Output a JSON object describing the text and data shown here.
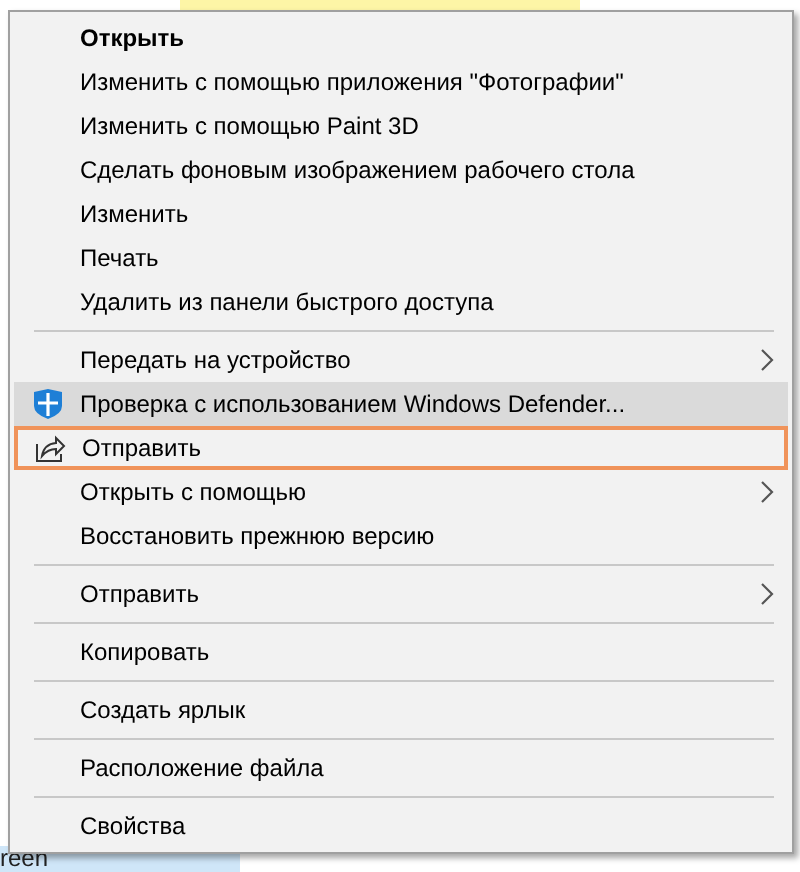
{
  "background": {
    "fragment_text": "reen"
  },
  "menu": {
    "items": [
      {
        "kind": "plain",
        "label": "Открыть",
        "default": true,
        "highlighted": false,
        "focused": false,
        "submenu": false
      },
      {
        "kind": "plain",
        "label": "Изменить с помощью приложения \"Фотографии\"",
        "default": false,
        "highlighted": false,
        "focused": false,
        "submenu": false
      },
      {
        "kind": "plain",
        "label": "Изменить с помощью Paint 3D",
        "default": false,
        "highlighted": false,
        "focused": false,
        "submenu": false
      },
      {
        "kind": "plain",
        "label": "Сделать фоновым изображением рабочего стола",
        "default": false,
        "highlighted": false,
        "focused": false,
        "submenu": false
      },
      {
        "kind": "plain",
        "label": "Изменить",
        "default": false,
        "highlighted": false,
        "focused": false,
        "submenu": false
      },
      {
        "kind": "plain",
        "label": "Печать",
        "default": false,
        "highlighted": false,
        "focused": false,
        "submenu": false
      },
      {
        "kind": "plain",
        "label": "Удалить из панели быстрого доступа",
        "default": false,
        "highlighted": false,
        "focused": false,
        "submenu": false
      },
      {
        "kind": "separator"
      },
      {
        "kind": "plain",
        "label": "Передать на устройство",
        "default": false,
        "highlighted": false,
        "focused": false,
        "submenu": true
      },
      {
        "kind": "shield",
        "label": "Проверка с использованием Windows Defender...",
        "default": false,
        "highlighted": true,
        "focused": false,
        "submenu": false
      },
      {
        "kind": "share",
        "label": "Отправить",
        "default": false,
        "highlighted": false,
        "focused": true,
        "submenu": false
      },
      {
        "kind": "plain",
        "label": "Открыть с помощью",
        "default": false,
        "highlighted": false,
        "focused": false,
        "submenu": true
      },
      {
        "kind": "plain",
        "label": "Восстановить прежнюю версию",
        "default": false,
        "highlighted": false,
        "focused": false,
        "submenu": false
      },
      {
        "kind": "separator"
      },
      {
        "kind": "plain",
        "label": "Отправить",
        "default": false,
        "highlighted": false,
        "focused": false,
        "submenu": true
      },
      {
        "kind": "separator"
      },
      {
        "kind": "plain",
        "label": "Копировать",
        "default": false,
        "highlighted": false,
        "focused": false,
        "submenu": false
      },
      {
        "kind": "separator"
      },
      {
        "kind": "plain",
        "label": "Создать ярлык",
        "default": false,
        "highlighted": false,
        "focused": false,
        "submenu": false
      },
      {
        "kind": "separator"
      },
      {
        "kind": "plain",
        "label": "Расположение файла",
        "default": false,
        "highlighted": false,
        "focused": false,
        "submenu": false
      },
      {
        "kind": "separator"
      },
      {
        "kind": "plain",
        "label": "Свойства",
        "default": false,
        "highlighted": false,
        "focused": false,
        "submenu": false
      }
    ]
  }
}
